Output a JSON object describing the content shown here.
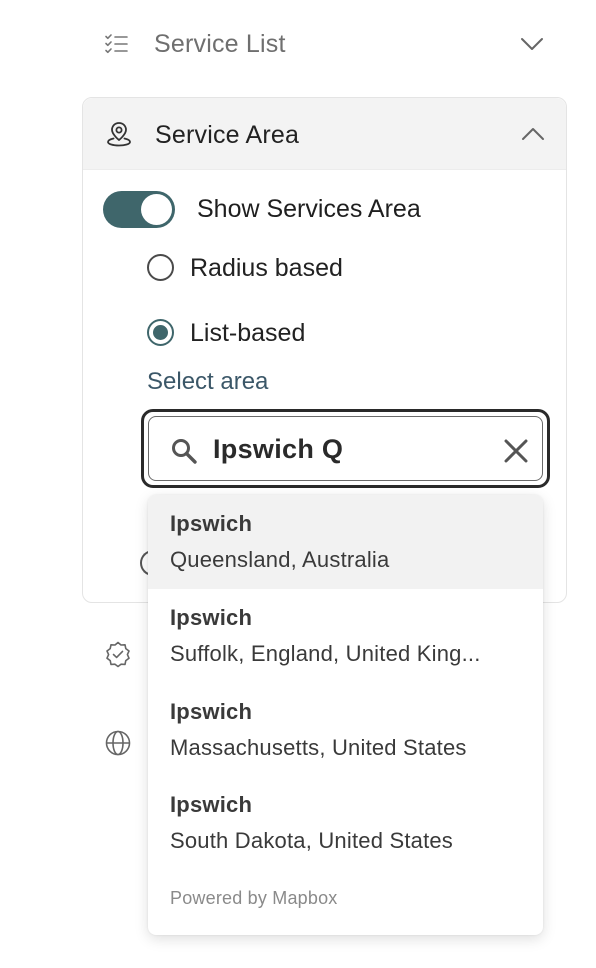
{
  "service_list": {
    "label": "Service List",
    "icon": "checklist-icon",
    "chevron": "chevron-down-icon"
  },
  "service_area": {
    "label": "Service Area",
    "icon": "location-pin-icon",
    "chevron": "chevron-up-icon",
    "toggle": {
      "label": "Show Services Area",
      "on": true
    },
    "radios": [
      {
        "label": "Radius based",
        "checked": false
      },
      {
        "label": "List-based",
        "checked": true
      }
    ],
    "select_area_label": "Select area",
    "search": {
      "value": "Ipswich Q",
      "icon": "search-icon",
      "clear_icon": "close-icon"
    }
  },
  "suggestions": [
    {
      "name": "Ipswich",
      "place": "Queensland, Australia"
    },
    {
      "name": "Ipswich",
      "place": "Suffolk, England, United King..."
    },
    {
      "name": "Ipswich",
      "place": "Massachusetts, United States"
    },
    {
      "name": "Ipswich",
      "place": "South Dakota, United States"
    }
  ],
  "powered_by": "Powered by Mapbox",
  "side_icons": [
    "verified-badge-icon",
    "globe-icon"
  ],
  "colors": {
    "accent": "#3f666b",
    "select_label": "#3b5768",
    "muted_text": "#6f6f6f"
  }
}
